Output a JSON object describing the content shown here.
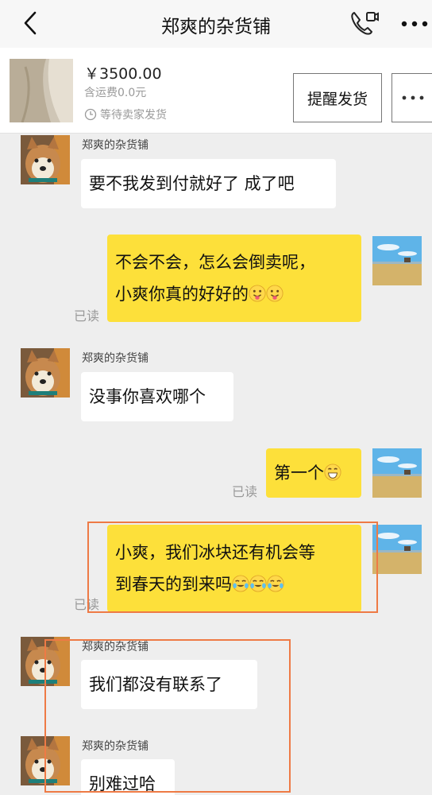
{
  "header": {
    "title": "郑爽的杂货铺"
  },
  "order": {
    "price": "￥3500.00",
    "shipping": "含运费0.0元",
    "status": "等待卖家发货",
    "remind_button": "提醒发货"
  },
  "chat": {
    "seller_name": "郑爽的杂货铺",
    "read_label": "已读",
    "messages": [
      {
        "text": "要不我发到付就好了 成了吧"
      },
      {
        "line1": "不会不会，怎么会倒卖呢，",
        "line2": "小爽你真的好好的"
      },
      {
        "text": "没事你喜欢哪个"
      },
      {
        "text": "第一个"
      },
      {
        "line1": "小爽，我们冰块还有机会等",
        "line2": "到春天的到来吗"
      },
      {
        "text": "我们都没有联系了"
      },
      {
        "text": "别难过哈"
      }
    ]
  },
  "colors": {
    "own_bubble": "#fde03a",
    "highlight_border": "#ee7a45"
  }
}
